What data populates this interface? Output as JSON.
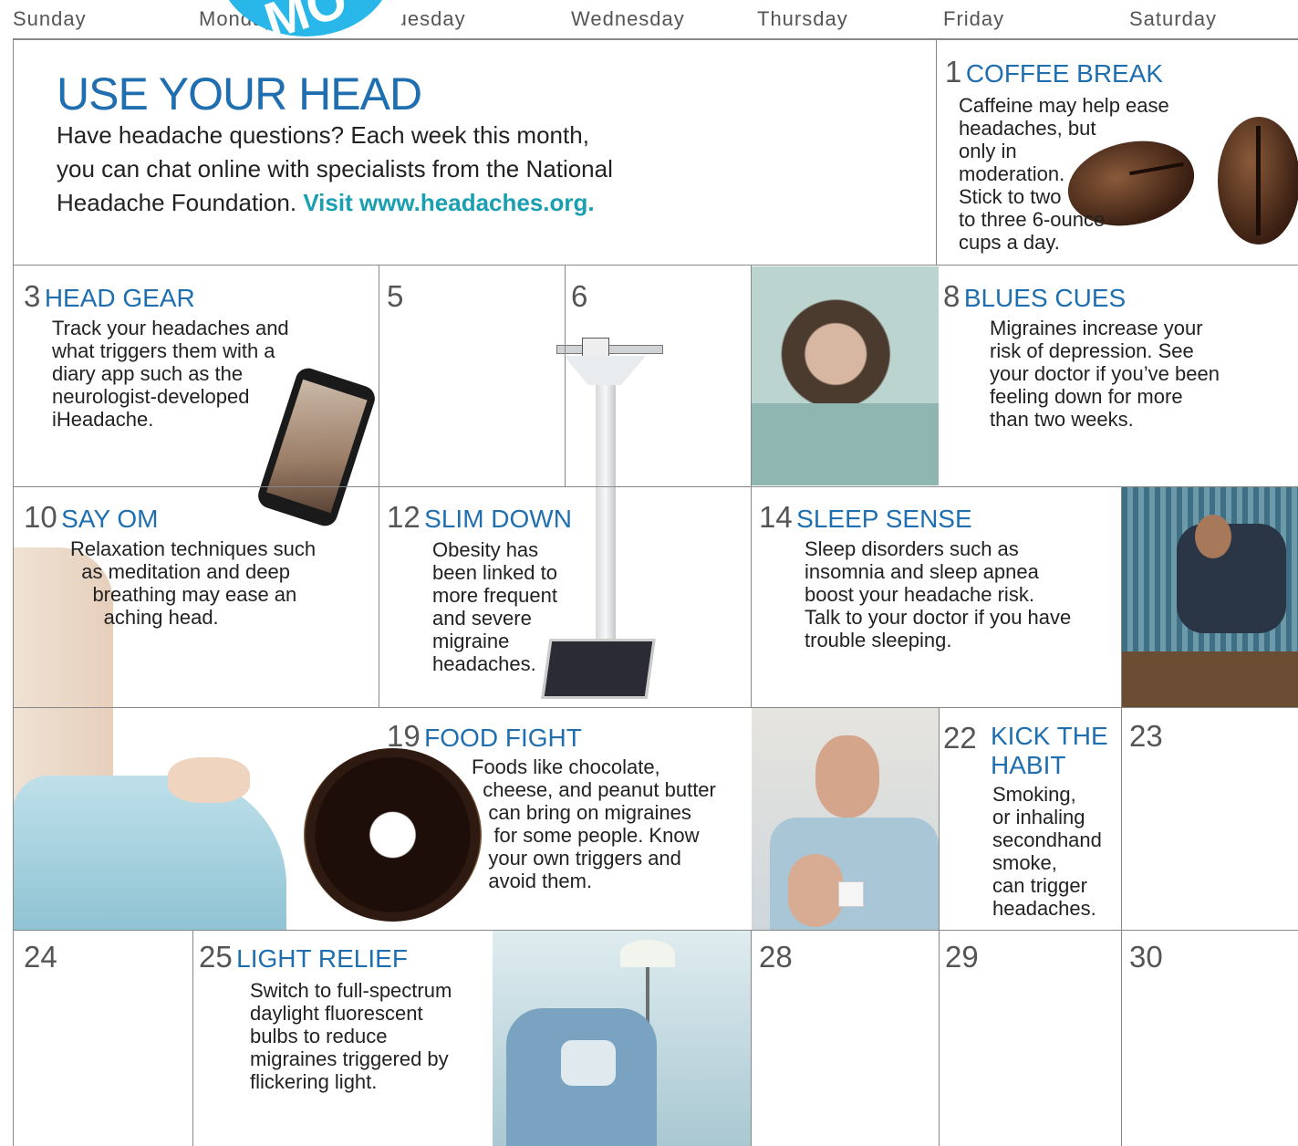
{
  "weekdays": [
    "Sunday",
    "Monday",
    "Tuesday",
    "Wednesday",
    "Thursday",
    "Friday",
    "Saturday"
  ],
  "badge_text": "MO",
  "intro": {
    "title": "USE YOUR HEAD",
    "text": "Have headache questions? Each week this month,\nyou can chat online with specialists from the National\nHeadache Foundation. ",
    "link": "Visit www.headaches.org."
  },
  "tips": [
    {
      "day": "1",
      "title": "COFFEE BREAK",
      "text": "Caffeine may help ease\nheadaches, but\nonly in\nmoderation.\nStick to two\nto three 6-ounce\ncups a day."
    },
    {
      "day": "3",
      "title": "HEAD GEAR",
      "text": "Track your headaches and\nwhat triggers them with a\ndiary app such as the\nneurologist-developed\niHeadache."
    },
    {
      "day": "8",
      "title": "BLUES CUES",
      "text": "Migraines increase your\nrisk of depression. See\nyour doctor if you’ve been\nfeeling down for more\nthan two weeks."
    },
    {
      "day": "10",
      "title": "SAY OM",
      "text": "Relaxation techniques such\n  as meditation and deep\n    breathing may ease an\n      aching head."
    },
    {
      "day": "12",
      "title": "SLIM DOWN",
      "text": "Obesity has\nbeen linked to\nmore frequent\nand severe\nmigraine\nheadaches."
    },
    {
      "day": "14",
      "title": "SLEEP SENSE",
      "text": "Sleep disorders such as\ninsomnia and sleep apnea\nboost your headache risk.\nTalk to your doctor if you have\ntrouble sleeping."
    },
    {
      "day": "19",
      "title": "FOOD FIGHT",
      "text": "Foods like chocolate,\n  cheese, and peanut butter\n   can bring on migraines\n    for some people. Know\n   your own triggers and\n   avoid them."
    },
    {
      "day": "22",
      "title": "KICK THE\nHABIT",
      "text": "Smoking,\nor inhaling\nsecondhand\nsmoke,\ncan trigger\nheadaches."
    },
    {
      "day": "25",
      "title": "LIGHT RELIEF",
      "text": "Switch to full-spectrum\ndaylight fluorescent\nbulbs to reduce\nmigraines triggered by\nflickering light."
    }
  ],
  "empty_days": [
    "5",
    "6",
    "23",
    "24",
    "28",
    "29",
    "30"
  ]
}
